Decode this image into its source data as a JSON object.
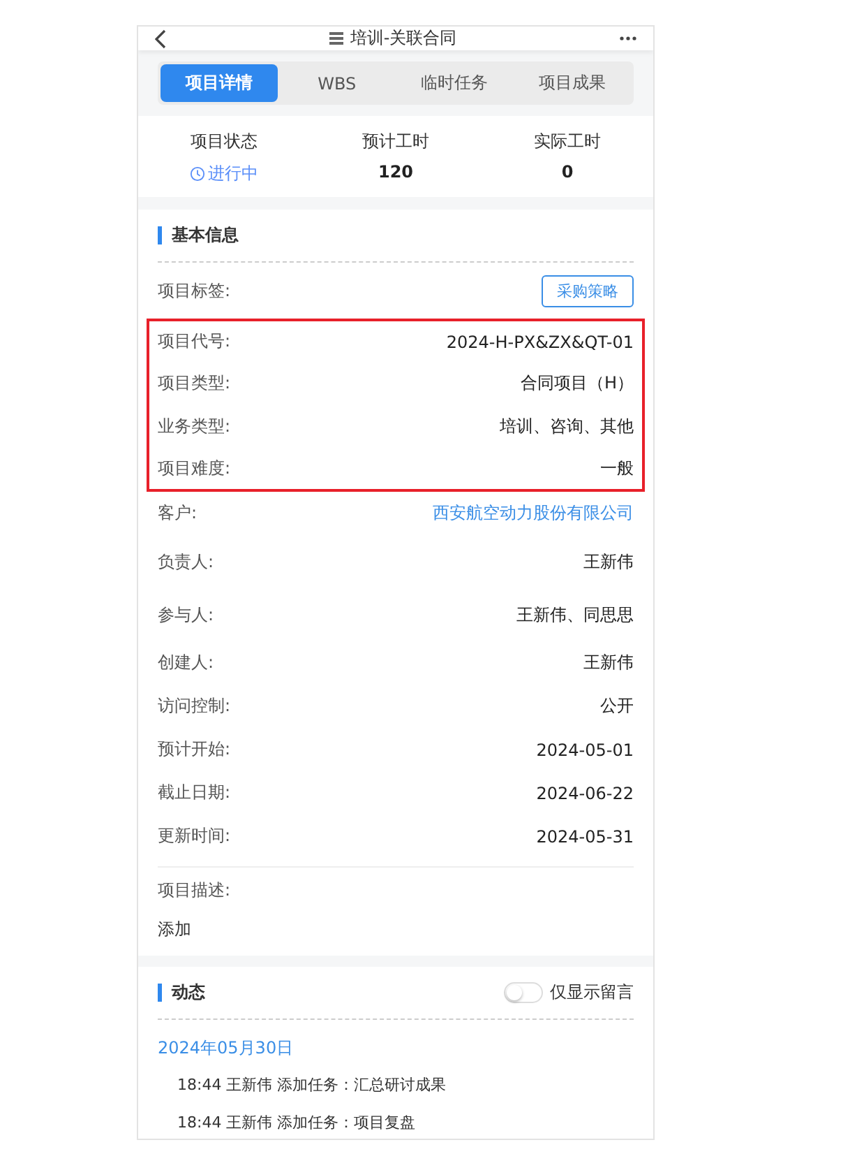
{
  "header": {
    "title": "培训-关联合同"
  },
  "tabs": [
    {
      "label": "项目详情",
      "selected": true
    },
    {
      "label": "WBS",
      "selected": false
    },
    {
      "label": "临时任务",
      "selected": false
    },
    {
      "label": "项目成果",
      "selected": false
    }
  ],
  "stats": [
    {
      "label": "项目状态",
      "value": "进行中",
      "kind": "status"
    },
    {
      "label": "预计工时",
      "value": "120",
      "kind": "number"
    },
    {
      "label": "实际工时",
      "value": "0",
      "kind": "number"
    }
  ],
  "basic_info": {
    "title": "基本信息",
    "fields": [
      {
        "label": "项目标签:",
        "value": "采购策略",
        "kind": "tag",
        "highlighted": false
      },
      {
        "label": "项目代号:",
        "value": "2024-H-PX&ZX&QT-01",
        "kind": "text",
        "highlighted": true
      },
      {
        "label": "项目类型:",
        "value": "合同项目（H）",
        "kind": "text",
        "highlighted": true
      },
      {
        "label": "业务类型:",
        "value": "培训、咨询、其他",
        "kind": "text",
        "highlighted": true
      },
      {
        "label": "项目难度:",
        "value": "一般",
        "kind": "text",
        "highlighted": true
      },
      {
        "label": "客户:",
        "value": "西安航空动力股份有限公司",
        "kind": "link",
        "highlighted": false
      },
      {
        "label": "负责人:",
        "value": "王新伟",
        "kind": "text",
        "highlighted": false
      },
      {
        "label": "参与人:",
        "value": "王新伟、同思思",
        "kind": "text",
        "highlighted": false
      },
      {
        "label": "创建人:",
        "value": "王新伟",
        "kind": "text",
        "highlighted": false
      },
      {
        "label": "访问控制:",
        "value": "公开",
        "kind": "text",
        "highlighted": false
      },
      {
        "label": "预计开始:",
        "value": "2024-05-01",
        "kind": "text",
        "highlighted": false
      },
      {
        "label": "截止日期:",
        "value": "2024-06-22",
        "kind": "text",
        "highlighted": false
      },
      {
        "label": "更新时间:",
        "value": "2024-05-31",
        "kind": "text",
        "highlighted": false
      }
    ],
    "description_label": "项目描述:",
    "description_action": "添加"
  },
  "activity": {
    "title": "动态",
    "toggle": {
      "label": "仅显示留言",
      "on": false
    },
    "date": "2024年05月30日",
    "entries": [
      "18:44 王新伟 添加任务：汇总研讨成果",
      "18:44 王新伟 添加任务：项目复盘"
    ]
  }
}
